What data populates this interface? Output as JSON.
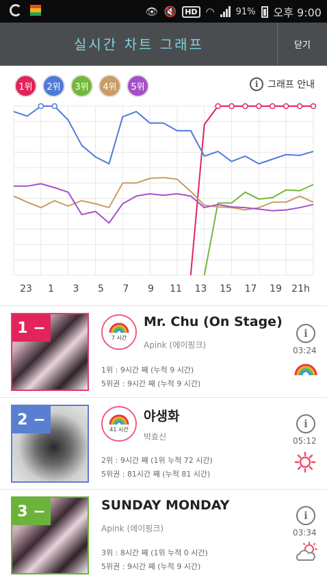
{
  "statusbar": {
    "battery": "91%",
    "time": "오후 9:00",
    "hd": "HD"
  },
  "header": {
    "title": "실시간 차트 그래프",
    "close_label": "닫기"
  },
  "legend": [
    {
      "label": "1위",
      "color": "#e2245a"
    },
    {
      "label": "2위",
      "color": "#4f7ad8"
    },
    {
      "label": "3위",
      "color": "#72b83a"
    },
    {
      "label": "4위",
      "color": "#c99c63"
    },
    {
      "label": "5위",
      "color": "#a550c9"
    }
  ],
  "guide_label": "그래프 안내",
  "chart_data": {
    "type": "line",
    "x": [
      "23",
      "0",
      "1",
      "2",
      "3",
      "4",
      "5",
      "6",
      "7",
      "8",
      "9",
      "10",
      "11",
      "12",
      "13",
      "14",
      "15",
      "16",
      "17",
      "18",
      "19",
      "20",
      "21"
    ],
    "x_tick_labels": [
      "23",
      "1",
      "3",
      "5",
      "7",
      "9",
      "11",
      "13",
      "15",
      "17",
      "19",
      "21h"
    ],
    "y_inverted": true,
    "ylim": [
      1,
      12
    ],
    "grid": true,
    "series": [
      {
        "color": "#e2245a",
        "values": [
          null,
          null,
          null,
          null,
          null,
          null,
          null,
          null,
          null,
          null,
          null,
          null,
          null,
          12,
          2.2,
          1,
          1,
          1,
          1,
          1,
          1,
          1,
          1
        ]
      },
      {
        "color": "#4f7ad8",
        "values": [
          1.35,
          1.65,
          1,
          1,
          1.9,
          3.55,
          4.3,
          4.75,
          1.7,
          1.35,
          2.1,
          2.1,
          2.6,
          2.6,
          4.25,
          3.95,
          4.6,
          4.25,
          4.75,
          4.45,
          4.15,
          4.2,
          3.95
        ]
      },
      {
        "color": "#72b83a",
        "values": [
          null,
          null,
          null,
          null,
          null,
          null,
          null,
          null,
          null,
          null,
          null,
          null,
          null,
          null,
          12,
          7.3,
          7.3,
          6.6,
          7.05,
          6.95,
          6.45,
          6.5,
          6.1
        ]
      },
      {
        "color": "#c99c63",
        "values": [
          6.85,
          7.25,
          7.6,
          7.15,
          7.5,
          7.15,
          7.35,
          7.6,
          6.0,
          6.0,
          5.7,
          5.65,
          5.75,
          6.55,
          7.45,
          7.55,
          7.6,
          7.75,
          7.6,
          7.25,
          7.25,
          6.85,
          7.25
        ]
      },
      {
        "color": "#a550c9",
        "values": [
          6.2,
          6.2,
          6.05,
          6.3,
          6.6,
          8.05,
          7.85,
          8.6,
          7.35,
          6.85,
          6.7,
          6.8,
          6.7,
          6.85,
          7.6,
          7.4,
          7.55,
          7.6,
          7.7,
          7.8,
          7.75,
          7.6,
          7.4
        ]
      }
    ]
  },
  "songs": [
    {
      "rank": "1",
      "rank_mark": "1 −",
      "rank_color": "#e2245a",
      "badge": "7 시간",
      "title": "Mr. Chu (On Stage)",
      "artist": "Apink (에이핑크)",
      "stat1": "1위 : 9시간 째 (누적 9 시간)",
      "stat2": "5위권 : 9시간 째 (누적 9 시간)",
      "duration": "03:24",
      "weather": "rainbow-icon"
    },
    {
      "rank": "2",
      "rank_mark": "2 −",
      "rank_color": "#5a7fd0",
      "badge": "41 시간",
      "title": "야생화",
      "artist": "박효신",
      "stat1": "2위 : 9시간 째 (1위 누적 72 시간)",
      "stat2": "5위권 : 81시간 째 (누적 81 시간)",
      "duration": "05:12",
      "weather": "sun-icon"
    },
    {
      "rank": "3",
      "rank_mark": "3 −",
      "rank_color": "#6cb33b",
      "badge": "",
      "title": "SUNDAY MONDAY",
      "artist": "Apink (에이핑크)",
      "stat1": "3위 : 8시간 째 (1위 누적 0 시간)",
      "stat2": "5위권 : 9시간 째 (누적 9 시간)",
      "duration": "03:34",
      "weather": "partly-cloudy-icon"
    }
  ]
}
